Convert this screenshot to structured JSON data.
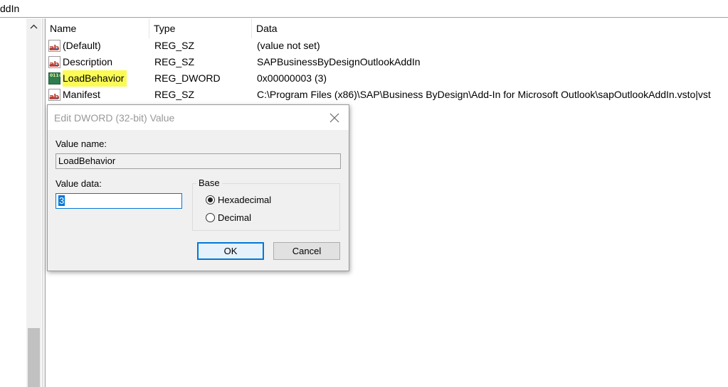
{
  "path_bar": {
    "text": "ddIn"
  },
  "columns": {
    "name": "Name",
    "type": "Type",
    "data": "Data"
  },
  "rows": [
    {
      "icon": "string-value-icon",
      "name": "(Default)",
      "type": "REG_SZ",
      "data": "(value not set)"
    },
    {
      "icon": "string-value-icon",
      "name": "Description",
      "type": "REG_SZ",
      "data": "SAPBusinessByDesignOutlookAddIn"
    },
    {
      "icon": "dword-value-icon",
      "name": "LoadBehavior",
      "type": "REG_DWORD",
      "data": "0x00000003 (3)",
      "highlighted": true
    },
    {
      "icon": "string-value-icon",
      "name": "Manifest",
      "type": "REG_SZ",
      "data": "C:\\Program Files (x86)\\SAP\\Business ByDesign\\Add-In for Microsoft Outlook\\sapOutlookAddIn.vsto|vst"
    }
  ],
  "dialog": {
    "title": "Edit DWORD (32-bit) Value",
    "value_name_label": "Value name:",
    "value_name": "LoadBehavior",
    "value_data_label": "Value data:",
    "value_data": "3",
    "base_label": "Base",
    "radio_hex": "Hexadecimal",
    "radio_dec": "Decimal",
    "selected_base": "Hexadecimal",
    "ok_label": "OK",
    "cancel_label": "Cancel"
  },
  "colors": {
    "highlight": "#fbfb55",
    "accent": "#0078d7"
  }
}
